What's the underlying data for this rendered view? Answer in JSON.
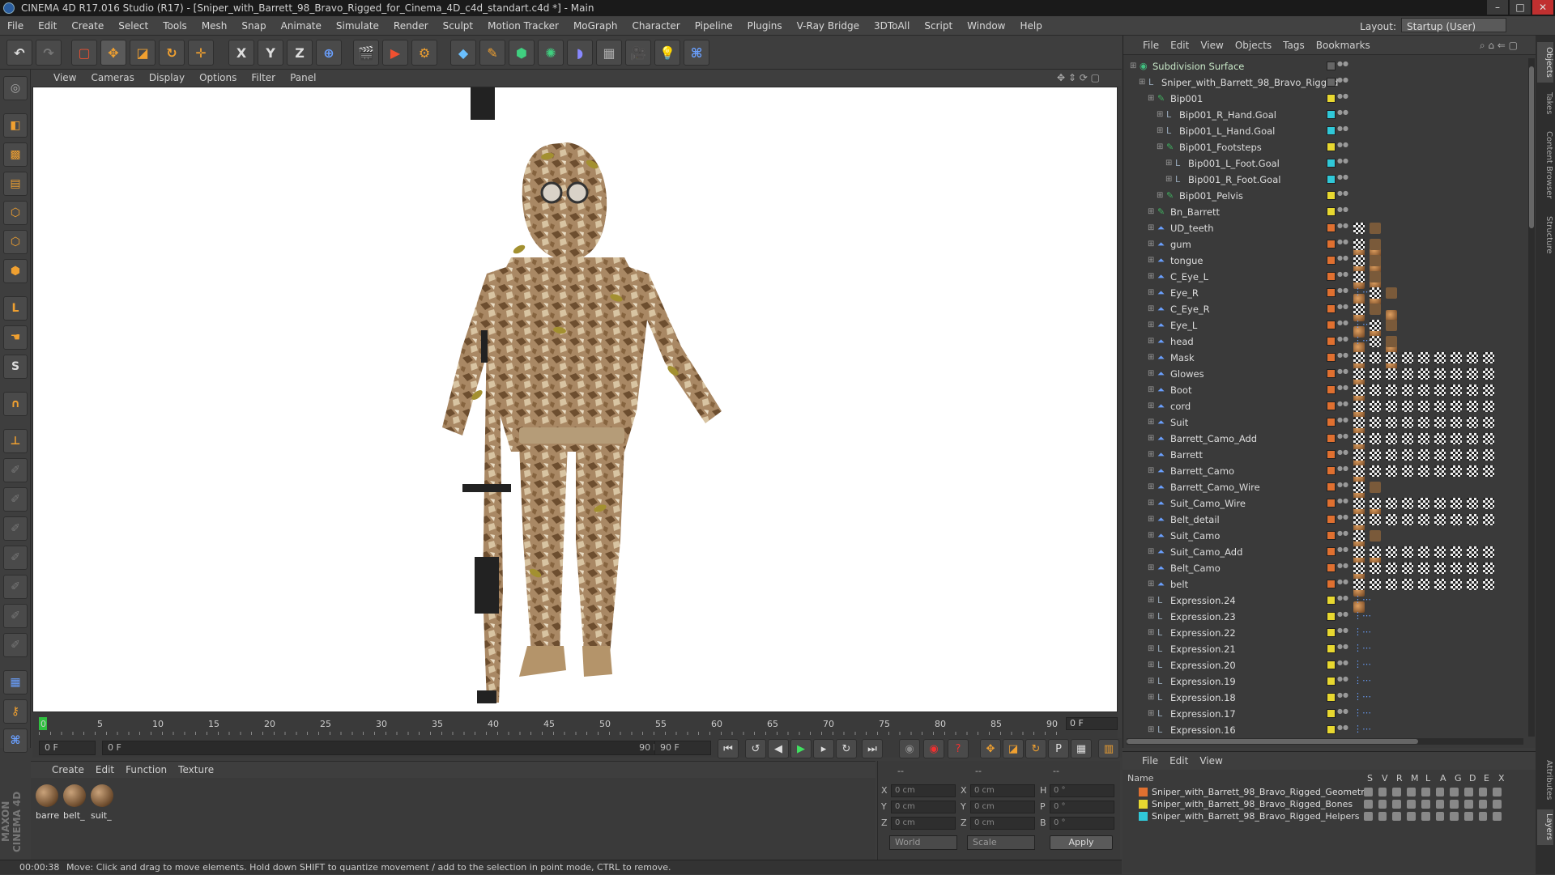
{
  "window": {
    "title": "CINEMA 4D R17.016 Studio (R17) - [Sniper_with_Barrett_98_Bravo_Rigged_for_Cinema_4D_c4d_standart.c4d *] - Main",
    "minimize": "–",
    "maximize": "□",
    "close": "✕"
  },
  "menu": [
    "File",
    "Edit",
    "Create",
    "Select",
    "Tools",
    "Mesh",
    "Snap",
    "Animate",
    "Simulate",
    "Render",
    "Sculpt",
    "Motion Tracker",
    "MoGraph",
    "Character",
    "Pipeline",
    "Plugins",
    "V-Ray Bridge",
    "3DToAll",
    "Script",
    "Window",
    "Help"
  ],
  "layout": {
    "label": "Layout:",
    "value": "Startup (User)"
  },
  "toolbar": {
    "x_label": "X",
    "y_label": "Y",
    "z_label": "Z"
  },
  "left_tools": {
    "s_label": "S",
    "l_label": "L"
  },
  "viewport_menu": [
    "View",
    "Cameras",
    "Display",
    "Options",
    "Filter",
    "Panel"
  ],
  "timeline": {
    "ticks": [
      "0",
      "5",
      "10",
      "15",
      "20",
      "25",
      "30",
      "35",
      "40",
      "45",
      "50",
      "55",
      "60",
      "65",
      "70",
      "75",
      "80",
      "85",
      "90"
    ],
    "current_frame": "0 F"
  },
  "transport": {
    "start_frame": "0 F",
    "range_start": "0 F",
    "range_end": "90 F",
    "end_frame": "90 F"
  },
  "material_menu": [
    "Create",
    "Edit",
    "Function",
    "Texture"
  ],
  "materials": [
    "barre",
    "belt_",
    "suit_"
  ],
  "coords": {
    "headers": [
      "--",
      "--",
      "--"
    ],
    "rows": [
      {
        "a": "X",
        "av": "0 cm",
        "b": "X",
        "bv": "0 cm",
        "c": "H",
        "cv": "0 °"
      },
      {
        "a": "Y",
        "av": "0 cm",
        "b": "Y",
        "bv": "0 cm",
        "c": "P",
        "cv": "0 °"
      },
      {
        "a": "Z",
        "av": "0 cm",
        "b": "Z",
        "bv": "0 cm",
        "c": "B",
        "cv": "0 °"
      }
    ],
    "mode1": "World",
    "mode2": "Scale",
    "apply": "Apply"
  },
  "status": {
    "time": "00:00:38",
    "message": "Move: Click and drag to move elements. Hold down SHIFT to quantize movement / add to the selection in point mode, CTRL to remove."
  },
  "object_menu": [
    "File",
    "Edit",
    "View",
    "Objects",
    "Tags",
    "Bookmarks"
  ],
  "objects": [
    {
      "name": "Subdivision Surface",
      "indent": 0,
      "type": "subdiv",
      "layer": "",
      "tags": []
    },
    {
      "name": "Sniper_with_Barrett_98_Bravo_Rigged",
      "indent": 1,
      "type": "null",
      "layer": "",
      "tags": []
    },
    {
      "name": "Bip001",
      "indent": 2,
      "type": "bone",
      "layer": "#e8d830",
      "tags": []
    },
    {
      "name": "Bip001_R_Hand.Goal",
      "indent": 3,
      "type": "null",
      "layer": "#30c8d8",
      "tags": []
    },
    {
      "name": "Bip001_L_Hand.Goal",
      "indent": 3,
      "type": "null",
      "layer": "#30c8d8",
      "tags": []
    },
    {
      "name": "Bip001_Footsteps",
      "indent": 3,
      "type": "bone",
      "layer": "#e8d830",
      "tags": []
    },
    {
      "name": "Bip001_L_Foot.Goal",
      "indent": 4,
      "type": "null",
      "layer": "#30c8d8",
      "tags": []
    },
    {
      "name": "Bip001_R_Foot.Goal",
      "indent": 4,
      "type": "null",
      "layer": "#30c8d8",
      "tags": []
    },
    {
      "name": "Bip001_Pelvis",
      "indent": 3,
      "type": "bone",
      "layer": "#e8d830",
      "tags": []
    },
    {
      "name": "Bn_Barrett",
      "indent": 2,
      "type": "bone",
      "layer": "#e8d830",
      "tags": []
    },
    {
      "name": "UD_teeth",
      "indent": 2,
      "type": "mesh",
      "layer": "#e07030",
      "tags": [
        "mat",
        "checker",
        "mat",
        "tex"
      ]
    },
    {
      "name": "gum",
      "indent": 2,
      "type": "mesh",
      "layer": "#e07030",
      "tags": [
        "mat",
        "checker",
        "mat",
        "tex"
      ]
    },
    {
      "name": "tongue",
      "indent": 2,
      "type": "mesh",
      "layer": "#e07030",
      "tags": [
        "mat",
        "checker",
        "mat",
        "tex"
      ]
    },
    {
      "name": "C_Eye_L",
      "indent": 2,
      "type": "mesh",
      "layer": "#e07030",
      "tags": [
        "mat",
        "checker",
        "mat",
        "tex"
      ]
    },
    {
      "name": "Eye_R",
      "indent": 2,
      "type": "mesh",
      "layer": "#e07030",
      "tags": [
        "mat",
        "exp",
        "checker",
        "mat",
        "tex"
      ]
    },
    {
      "name": "C_Eye_R",
      "indent": 2,
      "type": "mesh",
      "layer": "#e07030",
      "tags": [
        "mat",
        "checker",
        "mat",
        "tex"
      ]
    },
    {
      "name": "Eye_L",
      "indent": 2,
      "type": "mesh",
      "layer": "#e07030",
      "tags": [
        "mat",
        "exp",
        "checker",
        "mat",
        "tex"
      ]
    },
    {
      "name": "head",
      "indent": 2,
      "type": "mesh",
      "layer": "#e07030",
      "tags": [
        "mat",
        "exp",
        "checker",
        "mat",
        "tex"
      ]
    },
    {
      "name": "Mask",
      "indent": 2,
      "type": "mesh",
      "layer": "#e07030",
      "tags": [
        "mat",
        "checker",
        "checker",
        "checker",
        "checker",
        "checker",
        "checker",
        "checker",
        "checker",
        "checker"
      ]
    },
    {
      "name": "Glowes",
      "indent": 2,
      "type": "mesh",
      "layer": "#e07030",
      "tags": [
        "mat",
        "checker",
        "checker",
        "checker",
        "checker",
        "checker",
        "checker",
        "checker",
        "checker",
        "checker"
      ]
    },
    {
      "name": "Boot",
      "indent": 2,
      "type": "mesh",
      "layer": "#e07030",
      "tags": [
        "mat",
        "checker",
        "checker",
        "checker",
        "checker",
        "checker",
        "checker",
        "checker",
        "checker",
        "checker"
      ]
    },
    {
      "name": "cord",
      "indent": 2,
      "type": "mesh",
      "layer": "#e07030",
      "tags": [
        "mat",
        "checker",
        "checker",
        "checker",
        "checker",
        "checker",
        "checker",
        "checker",
        "checker",
        "checker"
      ]
    },
    {
      "name": "Suit",
      "indent": 2,
      "type": "mesh",
      "layer": "#e07030",
      "tags": [
        "mat",
        "checker",
        "checker",
        "checker",
        "checker",
        "checker",
        "checker",
        "checker",
        "checker",
        "checker"
      ]
    },
    {
      "name": "Barrett_Camo_Add",
      "indent": 2,
      "type": "mesh",
      "layer": "#e07030",
      "tags": [
        "mat",
        "checker",
        "checker",
        "checker",
        "checker",
        "checker",
        "checker",
        "checker",
        "checker",
        "checker"
      ]
    },
    {
      "name": "Barrett",
      "indent": 2,
      "type": "mesh",
      "layer": "#e07030",
      "tags": [
        "mat",
        "checker",
        "checker",
        "checker",
        "checker",
        "checker",
        "checker",
        "checker",
        "checker",
        "checker"
      ]
    },
    {
      "name": "Barrett_Camo",
      "indent": 2,
      "type": "mesh",
      "layer": "#e07030",
      "tags": [
        "mat",
        "checker",
        "checker",
        "checker",
        "checker",
        "checker",
        "checker",
        "checker",
        "checker",
        "checker"
      ]
    },
    {
      "name": "Barrett_Camo_Wire",
      "indent": 2,
      "type": "mesh",
      "layer": "#e07030",
      "tags": [
        "mat",
        "checker",
        "mat",
        "tex"
      ]
    },
    {
      "name": "Suit_Camo_Wire",
      "indent": 2,
      "type": "mesh",
      "layer": "#e07030",
      "tags": [
        "mat",
        "checker",
        "checker",
        "checker",
        "checker",
        "checker",
        "checker",
        "checker",
        "checker",
        "checker"
      ]
    },
    {
      "name": "Belt_detail",
      "indent": 2,
      "type": "mesh",
      "layer": "#e07030",
      "tags": [
        "mat",
        "checker",
        "checker",
        "checker",
        "checker",
        "checker",
        "checker",
        "checker",
        "checker",
        "checker"
      ]
    },
    {
      "name": "Suit_Camo",
      "indent": 2,
      "type": "mesh",
      "layer": "#e07030",
      "tags": [
        "mat",
        "checker",
        "mat",
        "tex"
      ]
    },
    {
      "name": "Suit_Camo_Add",
      "indent": 2,
      "type": "mesh",
      "layer": "#e07030",
      "tags": [
        "mat",
        "checker",
        "checker",
        "checker",
        "checker",
        "checker",
        "checker",
        "checker",
        "checker",
        "checker"
      ]
    },
    {
      "name": "Belt_Camo",
      "indent": 2,
      "type": "mesh",
      "layer": "#e07030",
      "tags": [
        "mat",
        "checker",
        "checker",
        "checker",
        "checker",
        "checker",
        "checker",
        "checker",
        "checker",
        "checker"
      ]
    },
    {
      "name": "belt",
      "indent": 2,
      "type": "mesh",
      "layer": "#e07030",
      "tags": [
        "mat",
        "checker",
        "checker",
        "checker",
        "checker",
        "checker",
        "checker",
        "checker",
        "checker",
        "checker"
      ]
    },
    {
      "name": "Expression.24",
      "indent": 2,
      "type": "null",
      "layer": "#e8d830",
      "tags": [
        "exp"
      ]
    },
    {
      "name": "Expression.23",
      "indent": 2,
      "type": "null",
      "layer": "#e8d830",
      "tags": [
        "exp"
      ]
    },
    {
      "name": "Expression.22",
      "indent": 2,
      "type": "null",
      "layer": "#e8d830",
      "tags": [
        "exp"
      ]
    },
    {
      "name": "Expression.21",
      "indent": 2,
      "type": "null",
      "layer": "#e8d830",
      "tags": [
        "exp"
      ]
    },
    {
      "name": "Expression.20",
      "indent": 2,
      "type": "null",
      "layer": "#e8d830",
      "tags": [
        "exp"
      ]
    },
    {
      "name": "Expression.19",
      "indent": 2,
      "type": "null",
      "layer": "#e8d830",
      "tags": [
        "exp"
      ]
    },
    {
      "name": "Expression.18",
      "indent": 2,
      "type": "null",
      "layer": "#e8d830",
      "tags": [
        "exp"
      ]
    },
    {
      "name": "Expression.17",
      "indent": 2,
      "type": "null",
      "layer": "#e8d830",
      "tags": [
        "exp"
      ]
    },
    {
      "name": "Expression.16",
      "indent": 2,
      "type": "null",
      "layer": "#e8d830",
      "tags": [
        "exp"
      ]
    }
  ],
  "layer_menu": [
    "File",
    "Edit",
    "View"
  ],
  "layer_headers": {
    "name": "Name",
    "cols": [
      "S",
      "V",
      "R",
      "M",
      "L",
      "A",
      "G",
      "D",
      "E",
      "X"
    ]
  },
  "layers": [
    {
      "name": "Sniper_with_Barrett_98_Bravo_Rigged_Geometry",
      "color": "#e07030"
    },
    {
      "name": "Sniper_with_Barrett_98_Bravo_Rigged_Bones",
      "color": "#e8d830"
    },
    {
      "name": "Sniper_with_Barrett_98_Bravo_Rigged_Helpers",
      "color": "#30c8d8"
    }
  ],
  "side_tabs": [
    "Objects",
    "Takes",
    "Content Browser",
    "Structure",
    "Attributes",
    "Layers"
  ],
  "brand": "MAXON CINEMA 4D"
}
